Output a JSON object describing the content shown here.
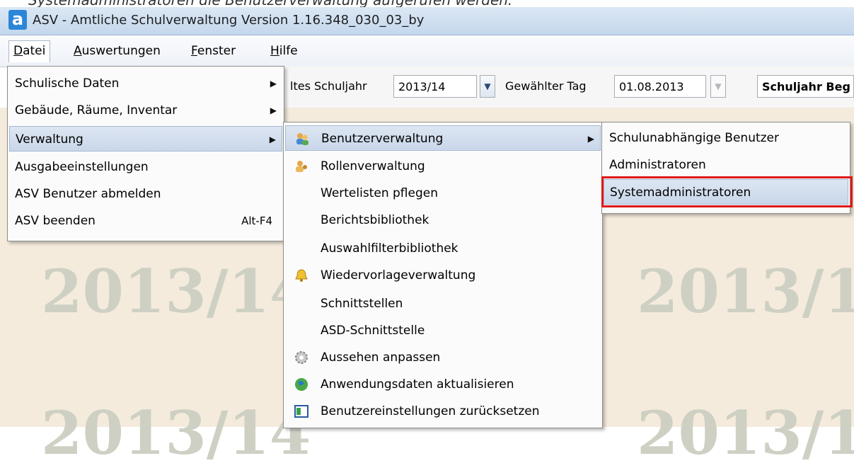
{
  "caption": "Systemadministratoren die Benutzerverwaltung aufgerufen werden:",
  "window": {
    "title": "ASV - Amtliche Schulverwaltung Version 1.16.348_030_03_by"
  },
  "menubar": [
    "Datei",
    "Auswertungen",
    "Fenster",
    "Hilfe"
  ],
  "toolbar": {
    "schuljahr_label": "ltes Schuljahr",
    "schuljahr_value": "2013/14",
    "tag_label": "Gewählter Tag",
    "tag_value": "01.08.2013",
    "beginn_value": "Schuljahr Beg"
  },
  "watermark": "2013/14",
  "datei_menu": [
    {
      "label": "Schulische Daten",
      "submenu": true
    },
    {
      "label": "Gebäude, Räume, Inventar",
      "submenu": true
    },
    {
      "label": "Verwaltung",
      "submenu": true,
      "highlighted": true
    },
    {
      "label": "Ausgabeeinstellungen"
    },
    {
      "label": "ASV Benutzer abmelden"
    },
    {
      "label": "ASV beenden",
      "shortcut": "Alt-F4"
    }
  ],
  "verwaltung_menu": [
    {
      "label": "Benutzerverwaltung",
      "icon": "users-icon",
      "submenu": true,
      "highlighted": true
    },
    {
      "label": "Rollenverwaltung",
      "icon": "roles-icon"
    },
    {
      "label": "Wertelisten pflegen"
    },
    {
      "label": "Berichtsbibliothek"
    },
    {
      "label": "Auswahlfilterbibliothek"
    },
    {
      "label": "Wiedervorlageverwaltung",
      "icon": "bell-icon"
    },
    {
      "label": "Schnittstellen"
    },
    {
      "label": "ASD-Schnittstelle"
    },
    {
      "label": "Aussehen anpassen",
      "icon": "gear-icon"
    },
    {
      "label": "Anwendungsdaten aktualisieren",
      "icon": "globe-icon"
    },
    {
      "label": "Benutzereinstellungen zurücksetzen",
      "icon": "reset-icon"
    }
  ],
  "benutzer_menu": [
    {
      "label": "Schulunabhängige Benutzer"
    },
    {
      "label": "Administratoren"
    },
    {
      "label": "Systemadministratoren",
      "highlighted": true,
      "marked": true
    }
  ],
  "colors": {
    "highlight": "#c9d7ea",
    "marker": "#e01818",
    "background": "#f4ebdc"
  }
}
